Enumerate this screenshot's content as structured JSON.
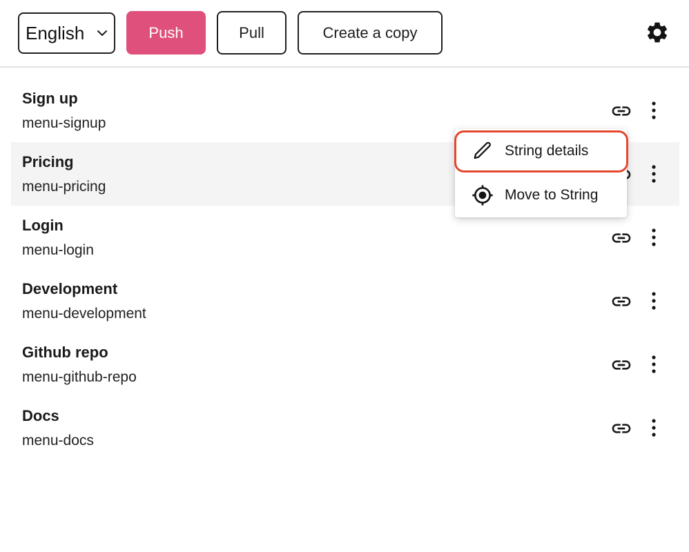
{
  "toolbar": {
    "language": {
      "selected": "English",
      "icon": "chevron-down-icon"
    },
    "push_label": "Push",
    "pull_label": "Pull",
    "copy_label": "Create a copy",
    "settings_icon": "gear-icon"
  },
  "strings": [
    {
      "title": "Sign up",
      "key": "menu-signup"
    },
    {
      "title": "Pricing",
      "key": "menu-pricing"
    },
    {
      "title": "Login",
      "key": "menu-login"
    },
    {
      "title": "Development",
      "key": "menu-development"
    },
    {
      "title": "Github repo",
      "key": "menu-github-repo"
    },
    {
      "title": "Docs",
      "key": "menu-docs"
    }
  ],
  "row_icons": {
    "link": "link-icon",
    "more": "more-vertical-icon"
  },
  "context_menu": {
    "items": [
      {
        "label": "String details",
        "icon": "pencil-icon",
        "focused": true
      },
      {
        "label": "Move to String",
        "icon": "target-icon",
        "focused": false
      }
    ]
  },
  "colors": {
    "accent": "#df507c",
    "focus_ring": "#e4472d",
    "row_highlight": "#f4f4f4",
    "divider": "#e2e2e2"
  }
}
